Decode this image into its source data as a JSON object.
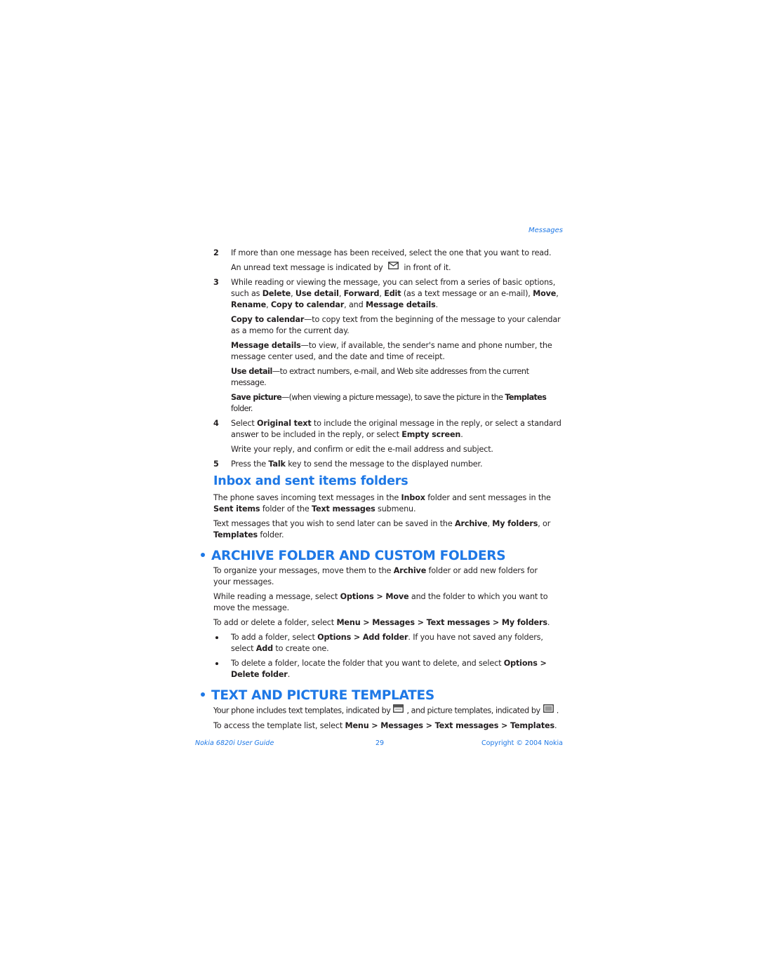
{
  "header": {
    "running_head": "Messages"
  },
  "steps": [
    {
      "number": "2",
      "text": [
        "If more than one message has been received, select the one that you want to read."
      ],
      "sub": [
        {
          "before_icon": "An unread text message is indicated by",
          "icon": "unread-message-envelope-icon",
          "after_icon": "in front of it."
        }
      ]
    },
    {
      "number": "3",
      "segments": [
        {
          "t": "While reading or viewing the message, you can select from a series of basic options, such as ",
          "b": false
        },
        {
          "t": "Delete",
          "b": true
        },
        {
          "t": ", ",
          "b": false
        },
        {
          "t": "Use detail",
          "b": true
        },
        {
          "t": ", ",
          "b": false
        },
        {
          "t": "Forward",
          "b": true
        },
        {
          "t": ", ",
          "b": false
        },
        {
          "t": "Edit",
          "b": true
        },
        {
          "t": " (as a text message or an e-mail), ",
          "b": false
        },
        {
          "t": "Move",
          "b": true
        },
        {
          "t": ", ",
          "b": false
        },
        {
          "t": "Rename",
          "b": true
        },
        {
          "t": ", ",
          "b": false
        },
        {
          "t": "Copy to calendar",
          "b": true
        },
        {
          "t": ", and ",
          "b": false
        },
        {
          "t": "Message details",
          "b": true
        },
        {
          "t": ".",
          "b": false
        }
      ],
      "options": [
        {
          "term": "Copy to calendar",
          "desc": "—to copy text from the beginning of the message to your calendar as a memo for the current day."
        },
        {
          "term": "Message details",
          "desc": "—to view, if available, the sender's name and phone number, the message center used, and the date and time of receipt."
        },
        {
          "term": "Use detail",
          "desc": "—to extract numbers, e-mail, and Web site addresses from the current message."
        },
        {
          "term": "Save picture",
          "desc": "—(when viewing a picture message), to save the picture in the ",
          "term2": "Templates",
          "desc2": " folder."
        }
      ]
    },
    {
      "number": "4",
      "segments": [
        {
          "t": "Select ",
          "b": false
        },
        {
          "t": "Original text",
          "b": true
        },
        {
          "t": " to include the original message in the reply, or select a standard answer to be included in the reply, or select ",
          "b": false
        },
        {
          "t": "Empty screen",
          "b": true
        },
        {
          "t": ".",
          "b": false
        }
      ],
      "sub_text": "Write your reply, and confirm or edit the e-mail address and subject."
    },
    {
      "number": "5",
      "segments": [
        {
          "t": "Press the ",
          "b": false
        },
        {
          "t": "Talk",
          "b": true
        },
        {
          "t": " key to send the message to the displayed number.",
          "b": false
        }
      ]
    }
  ],
  "inbox_section": {
    "heading": "Inbox and sent items folders",
    "p1": [
      {
        "t": "The phone saves incoming text messages in the ",
        "b": false
      },
      {
        "t": "Inbox",
        "b": true
      },
      {
        "t": " folder and sent messages in the ",
        "b": false
      },
      {
        "t": "Sent items",
        "b": true
      },
      {
        "t": " folder of the ",
        "b": false
      },
      {
        "t": "Text messages",
        "b": true
      },
      {
        "t": " submenu.",
        "b": false
      }
    ],
    "p2": [
      {
        "t": "Text messages that you wish to send later can be saved in the ",
        "b": false
      },
      {
        "t": "Archive",
        "b": true
      },
      {
        "t": ", ",
        "b": false
      },
      {
        "t": "My folders",
        "b": true
      },
      {
        "t": ", or ",
        "b": false
      },
      {
        "t": "Templates",
        "b": true
      },
      {
        "t": " folder.",
        "b": false
      }
    ]
  },
  "archive_section": {
    "heading": "Archive folder and custom folders",
    "p1": [
      {
        "t": "To organize your messages, move them to the ",
        "b": false
      },
      {
        "t": "Archive",
        "b": true
      },
      {
        "t": " folder or add new folders for your messages.",
        "b": false
      }
    ],
    "p2": [
      {
        "t": "While reading a message, select ",
        "b": false
      },
      {
        "t": "Options > Move",
        "b": true
      },
      {
        "t": " and the folder to which you want to move the message.",
        "b": false
      }
    ],
    "p3": [
      {
        "t": "To add or delete a folder, select ",
        "b": false
      },
      {
        "t": "Menu > Messages > Text messages > My folders",
        "b": true
      },
      {
        "t": ".",
        "b": false
      }
    ],
    "bullets": [
      [
        {
          "t": "To add a folder, select ",
          "b": false
        },
        {
          "t": "Options > Add folder",
          "b": true
        },
        {
          "t": ". If you have not saved any folders, select ",
          "b": false
        },
        {
          "t": "Add",
          "b": true
        },
        {
          "t": " to create one.",
          "b": false
        }
      ],
      [
        {
          "t": "To delete a folder, locate the folder that you want to delete, and select ",
          "b": false
        },
        {
          "t": "Options > Delete folder",
          "b": true
        },
        {
          "t": ".",
          "b": false
        }
      ]
    ]
  },
  "templates_section": {
    "heading": "Text and picture templates",
    "p1_a": "Your phone includes text templates, indicated by",
    "p1_b": ", and picture templates, indicated by",
    "p1_c": ".",
    "icons": [
      "text-template-icon",
      "picture-template-icon"
    ],
    "p2": [
      {
        "t": "To access the template list, select ",
        "b": false
      },
      {
        "t": "Menu > Messages > Text messages > Templates",
        "b": true
      },
      {
        "t": ".",
        "b": false
      }
    ]
  },
  "footer": {
    "guide_title": "Nokia 6820i User Guide",
    "page_number": "29",
    "copyright": "Copyright © 2004 Nokia"
  },
  "colors": {
    "accent": "#1e78e6",
    "text": "#231f20"
  }
}
